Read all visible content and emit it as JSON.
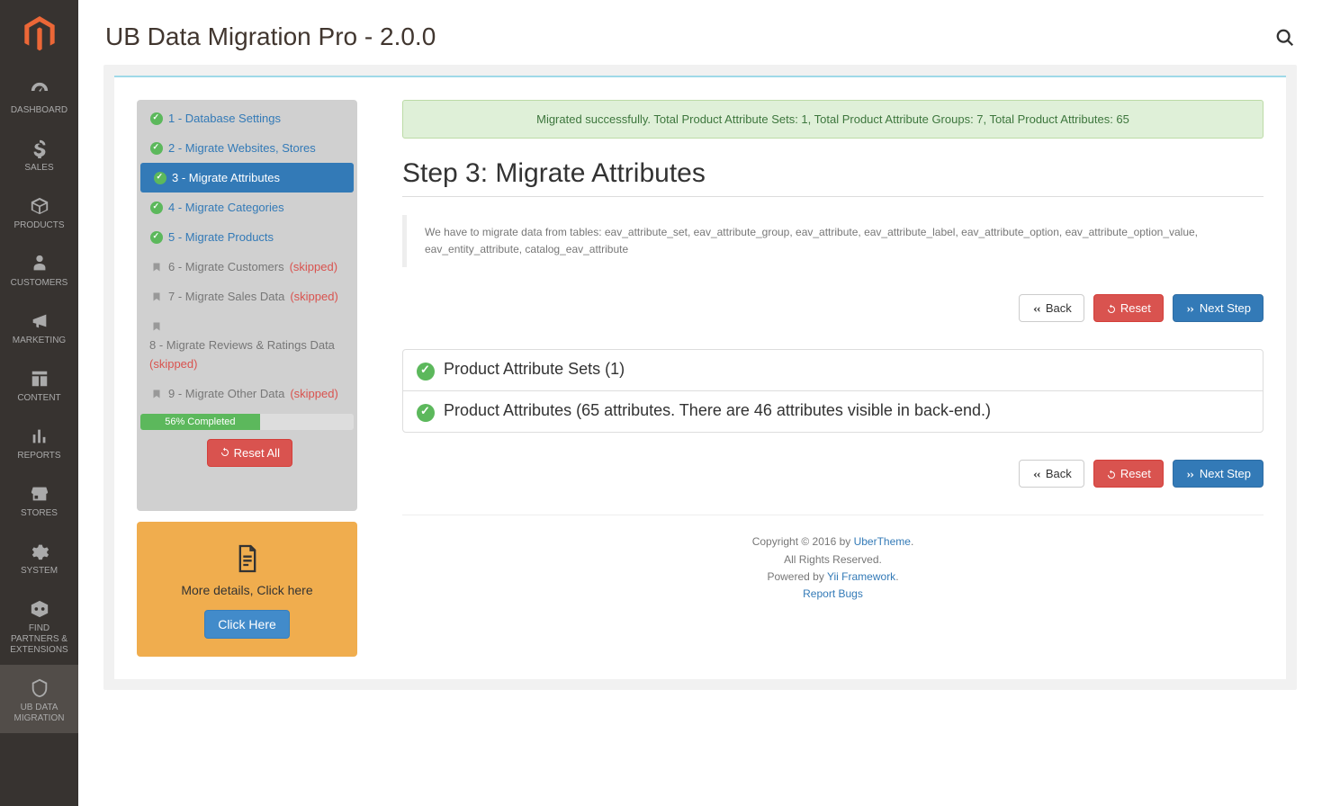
{
  "page_title": "UB Data Migration Pro - 2.0.0",
  "sidebar": {
    "items": [
      {
        "label": "DASHBOARD"
      },
      {
        "label": "SALES"
      },
      {
        "label": "PRODUCTS"
      },
      {
        "label": "CUSTOMERS"
      },
      {
        "label": "MARKETING"
      },
      {
        "label": "CONTENT"
      },
      {
        "label": "REPORTS"
      },
      {
        "label": "STORES"
      },
      {
        "label": "SYSTEM"
      },
      {
        "label": "FIND PARTNERS & EXTENSIONS"
      },
      {
        "label": "UB DATA MIGRATION"
      }
    ]
  },
  "steps": [
    {
      "label": "1 - Database Settings",
      "done": true,
      "skipped": false
    },
    {
      "label": "2 - Migrate Websites, Stores",
      "done": true,
      "skipped": false
    },
    {
      "label": "3 - Migrate Attributes",
      "done": true,
      "skipped": false,
      "active": true
    },
    {
      "label": "4 - Migrate Categories",
      "done": true,
      "skipped": false
    },
    {
      "label": "5 - Migrate Products",
      "done": true,
      "skipped": false
    },
    {
      "label": "6 - Migrate Customers",
      "done": false,
      "skipped": true
    },
    {
      "label": "7 - Migrate Sales Data",
      "done": false,
      "skipped": true
    },
    {
      "label": "8 - Migrate Reviews & Ratings Data",
      "done": false,
      "skipped": true
    },
    {
      "label": "9 - Migrate Other Data",
      "done": false,
      "skipped": true
    }
  ],
  "skipped_label": "(skipped)",
  "progress": {
    "percent": 56,
    "label": "56% Completed"
  },
  "reset_all": "Reset All",
  "more_box": {
    "text": "More details, Click here",
    "button": "Click Here"
  },
  "alert": "Migrated successfully. Total Product Attribute Sets: 1, Total Product Attribute Groups: 7, Total Product Attributes: 65",
  "step_title": "Step 3: Migrate Attributes",
  "info": "We have to migrate data from tables: eav_attribute_set, eav_attribute_group, eav_attribute, eav_attribute_label, eav_attribute_option, eav_attribute_option_value, eav_entity_attribute, catalog_eav_attribute",
  "buttons": {
    "back": "Back",
    "reset": "Reset",
    "next": "Next Step"
  },
  "panels": [
    "Product Attribute Sets (1)",
    "Product Attributes (65 attributes. There are 46 attributes visible in back-end.)"
  ],
  "footer": {
    "copyright": "Copyright © 2016 by ",
    "brand": "UberTheme",
    "rights": "All Rights Reserved.",
    "powered": "Powered by ",
    "framework": "Yii Framework",
    "report": "Report Bugs"
  }
}
